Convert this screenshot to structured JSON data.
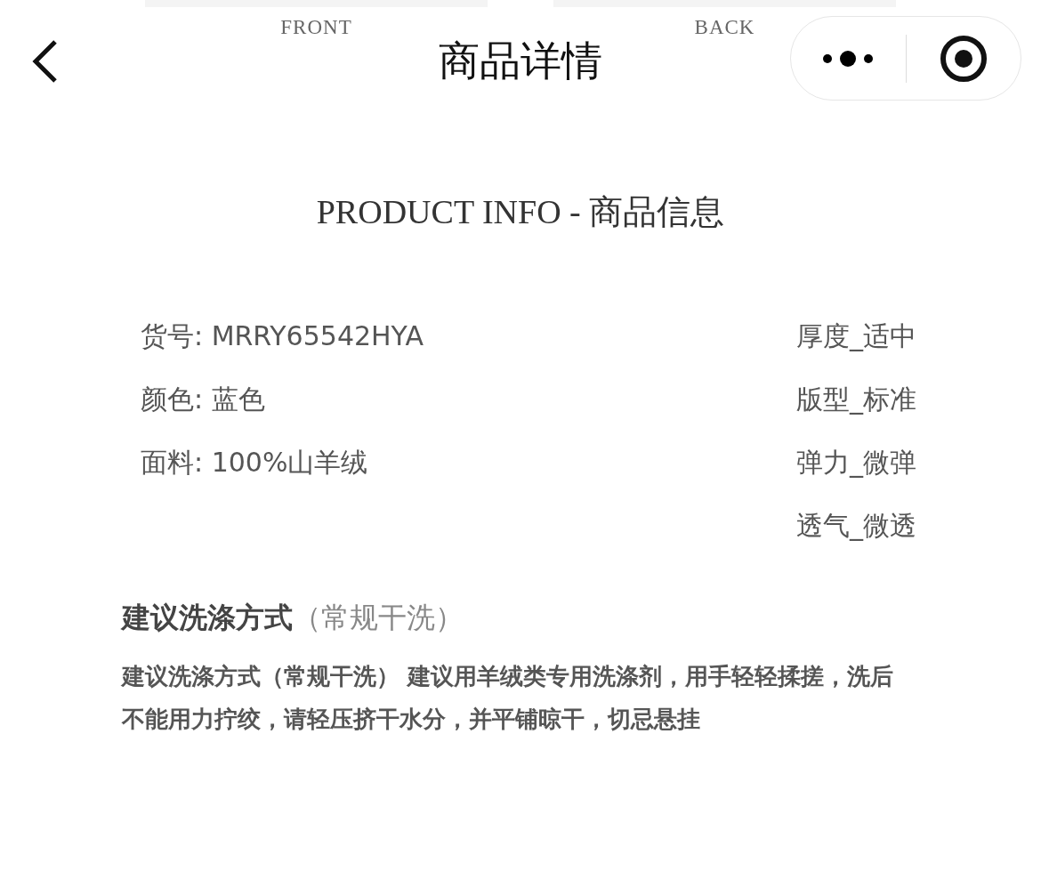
{
  "nav": {
    "title": "商品详情"
  },
  "views": [
    {
      "label": "FRONT"
    },
    {
      "label": "BACK"
    }
  ],
  "section_title": "PRODUCT INFO - 商品信息",
  "specs_left": [
    "货号: MRRY65542HYA",
    "颜色: 蓝色",
    "面料: 100%山羊绒"
  ],
  "specs_right": [
    "厚度_适中",
    "版型_标准",
    "弹力_微弹",
    "透气_微透"
  ],
  "care": {
    "heading": "**建议洗涤方式**（常规干洗）",
    "text": "建议洗涤方式（常规干洗） 建议用羊绒类专用洗涤剂，用手轻轻揉搓，洗后不能用力拧绞，请轻压挤干水分，并平铺晾干，切忌悬挂"
  }
}
